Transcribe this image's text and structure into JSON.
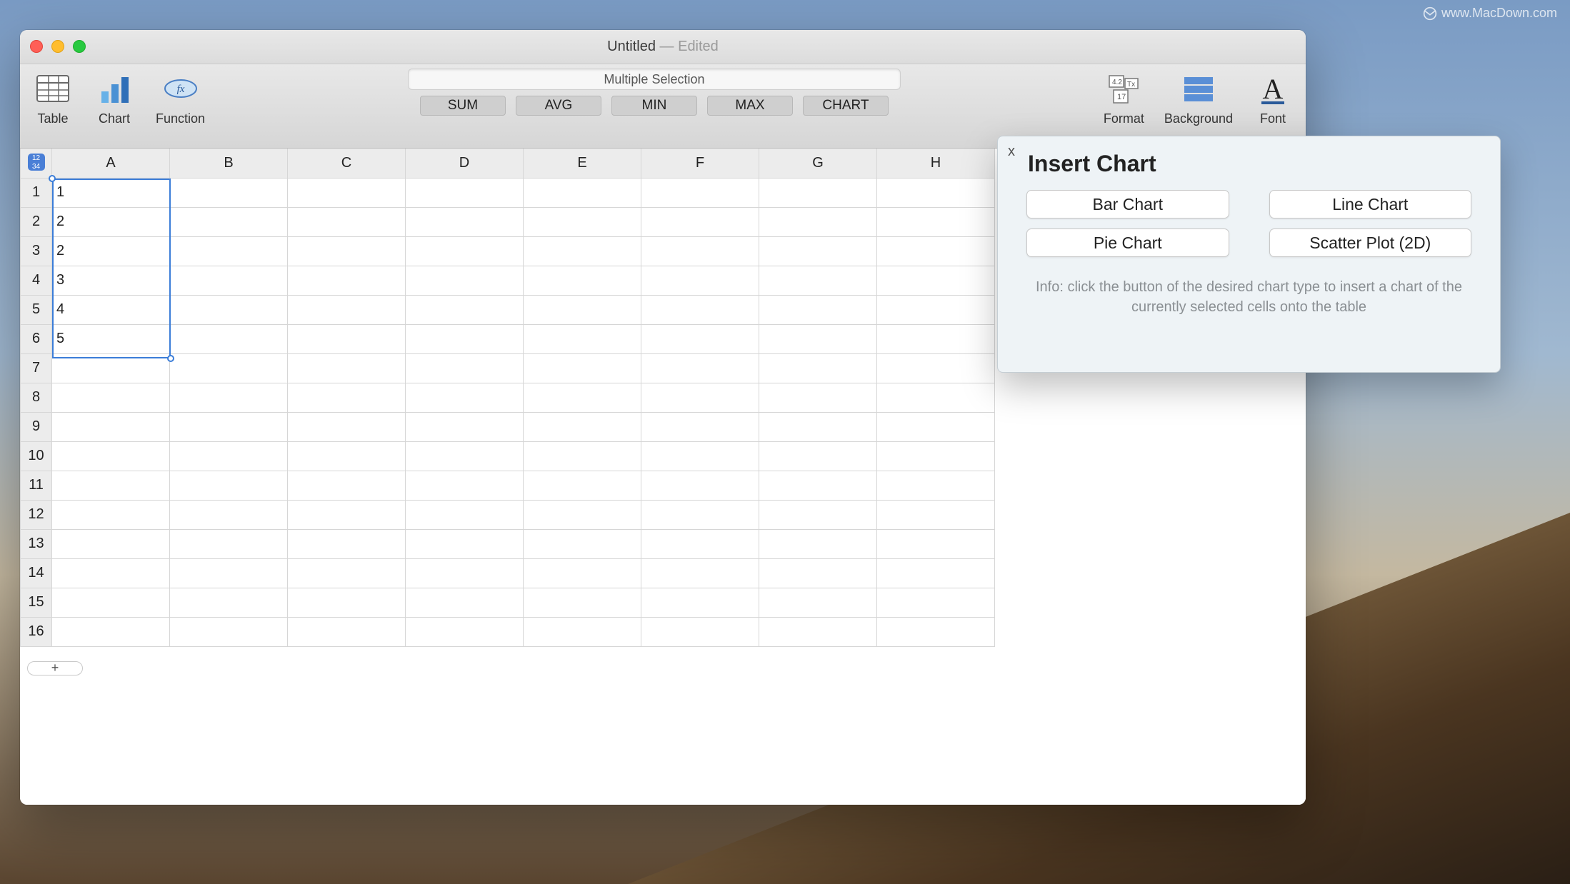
{
  "watermark": "www.MacDown.com",
  "window": {
    "title": "Untitled",
    "title_suffix": " — Edited"
  },
  "toolbar": {
    "left": [
      {
        "name": "table",
        "label": "Table"
      },
      {
        "name": "chart",
        "label": "Chart"
      },
      {
        "name": "function",
        "label": "Function"
      }
    ],
    "formula_display": "Multiple Selection",
    "func_buttons": [
      "SUM",
      "AVG",
      "MIN",
      "MAX",
      "CHART"
    ],
    "right": [
      {
        "name": "format",
        "label": "Format"
      },
      {
        "name": "background",
        "label": "Background"
      },
      {
        "name": "font",
        "label": "Font"
      }
    ]
  },
  "sheet": {
    "columns": [
      "A",
      "B",
      "C",
      "D",
      "E",
      "F",
      "G",
      "H"
    ],
    "row_count": 16,
    "cells": {
      "A1": "1",
      "A2": "2",
      "A3": "2",
      "A4": "3",
      "A5": "4",
      "A6": "5"
    },
    "selection": {
      "from": "A1",
      "to": "A6"
    },
    "add_button": "+"
  },
  "panel": {
    "title": "Insert Chart",
    "close": "x",
    "buttons": [
      "Bar Chart",
      "Line Chart",
      "Pie Chart",
      "Scatter Plot (2D)"
    ],
    "info": "Info: click the button of the desired chart type to insert a chart of the currently selected cells onto the table"
  }
}
